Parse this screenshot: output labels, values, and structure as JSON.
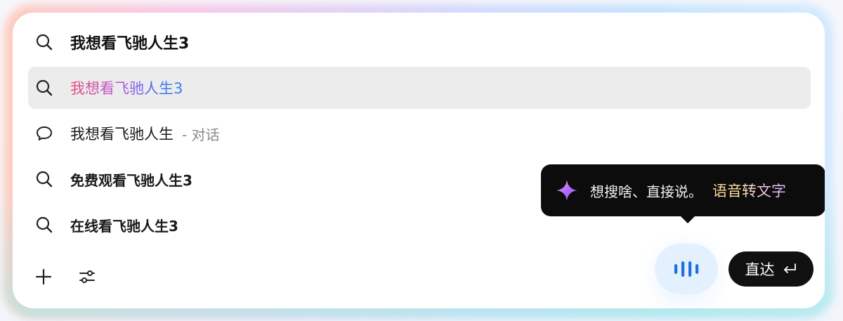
{
  "search": {
    "query": "我想看飞驰人生3"
  },
  "suggestions": [
    {
      "text": "我想看飞驰人生3",
      "icon": "search-icon",
      "selected": true
    },
    {
      "text": "我想看飞驰人生",
      "suffix": "- 对话",
      "icon": "chat-bubble-icon"
    },
    {
      "text": "免费观看飞驰人生3",
      "icon": "search-icon"
    },
    {
      "text": "在线看飞驰人生3",
      "icon": "search-icon"
    }
  ],
  "tooltip": {
    "text": "想搜啥、直接说。",
    "highlight": "语音转文字",
    "icon": "sparkle-icon"
  },
  "actions": {
    "add_icon": "plus-icon",
    "settings_icon": "sliders-icon",
    "voice_icon": "voice-wave-icon",
    "go_label": "直达",
    "go_icon": "enter-icon"
  },
  "colors": {
    "selected_bg": "#ececec",
    "tooltip_bg": "#0c0c0c",
    "voice_bg": "#e3f1ff",
    "voice_accent": "#1e6fe0",
    "go_bg": "#111111"
  }
}
